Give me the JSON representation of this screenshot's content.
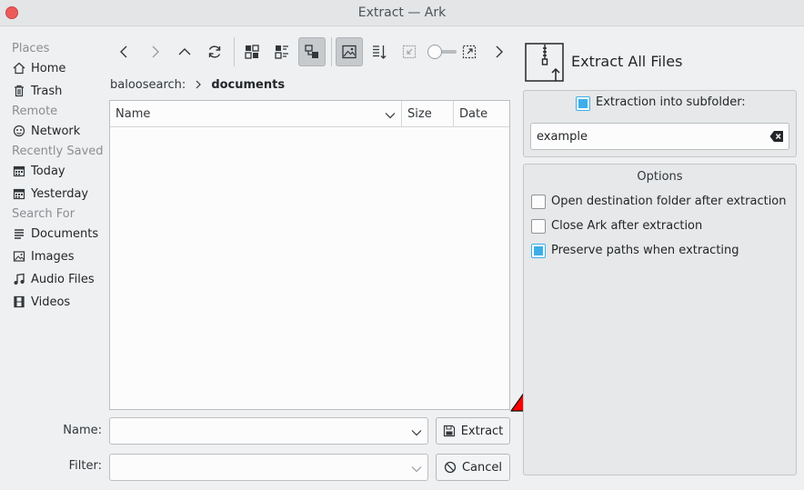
{
  "window": {
    "title": "Extract — Ark"
  },
  "sidebar": {
    "sections": [
      {
        "heading": "Places",
        "items": [
          {
            "label": "Home",
            "icon": "home-icon"
          },
          {
            "label": "Trash",
            "icon": "trash-icon"
          }
        ]
      },
      {
        "heading": "Remote",
        "items": [
          {
            "label": "Network",
            "icon": "network-icon"
          }
        ]
      },
      {
        "heading": "Recently Saved",
        "items": [
          {
            "label": "Today",
            "icon": "calendar-icon"
          },
          {
            "label": "Yesterday",
            "icon": "calendar-icon"
          }
        ]
      },
      {
        "heading": "Search For",
        "items": [
          {
            "label": "Documents",
            "icon": "document-icon"
          },
          {
            "label": "Images",
            "icon": "image-icon"
          },
          {
            "label": "Audio Files",
            "icon": "music-icon"
          },
          {
            "label": "Videos",
            "icon": "video-icon"
          }
        ]
      }
    ]
  },
  "toolbar": {
    "buttons": [
      "back-icon",
      "forward-icon",
      "up-icon",
      "reload-icon",
      "icon-view-icon",
      "detailed-view-icon",
      "tree-view-icon",
      "preview-icon",
      "sort-icon",
      "hidden-files-icon",
      "zoom-slider",
      "split-view-icon",
      "more-icon"
    ]
  },
  "breadcrumb": {
    "parent": "baloosearch:",
    "current": "documents"
  },
  "file_list": {
    "columns": [
      "Name",
      "Size",
      "Date"
    ],
    "rows": []
  },
  "form": {
    "name_label": "Name:",
    "name_value": "",
    "filter_label": "Filter:",
    "filter_value": "",
    "extract_label": "Extract",
    "cancel_label": "Cancel"
  },
  "right_panel": {
    "title": "Extract All Files",
    "subfolder_label": "Extraction into subfolder:",
    "subfolder_checked": true,
    "subfolder_value": "example",
    "options_title": "Options",
    "options": [
      {
        "label": "Open destination folder after extraction",
        "checked": false
      },
      {
        "label": "Close Ark after extraction",
        "checked": false
      },
      {
        "label": "Preserve paths when extracting",
        "checked": true
      }
    ]
  },
  "colors": {
    "accent": "#3daee9",
    "annotation": "#ff0000"
  }
}
